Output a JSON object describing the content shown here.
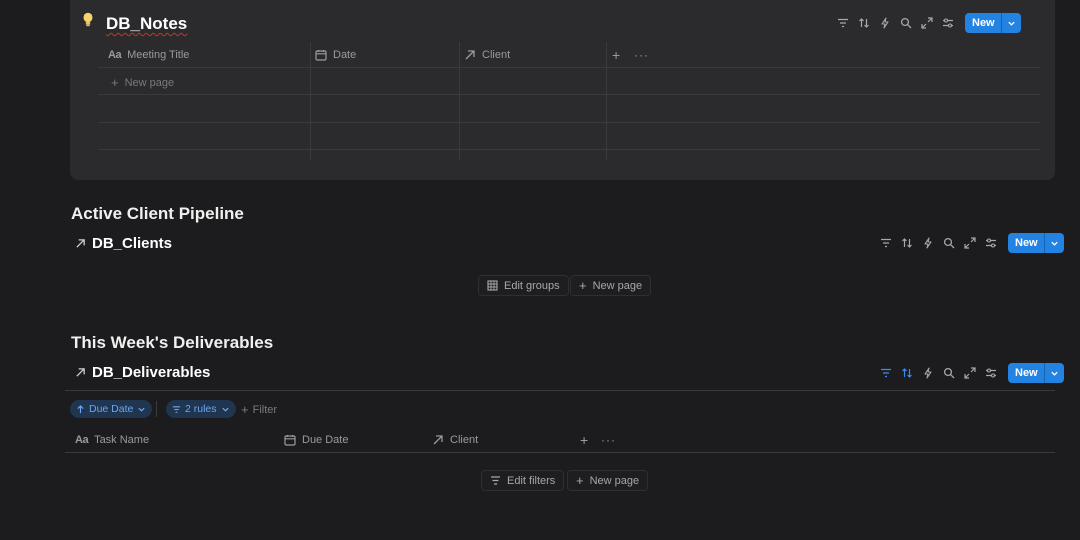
{
  "notes": {
    "title": "DB_Notes",
    "icon": "lightbulb-icon",
    "columns": [
      "Meeting Title",
      "Date",
      "Client"
    ],
    "column_icons": [
      "text-aa-icon",
      "calendar-icon",
      "relation-arrow-icon"
    ],
    "aa_glyph": "Aa",
    "new_page_label": "New page",
    "new_button_label": "New"
  },
  "clients_section": {
    "heading": "Active Client Pipeline",
    "db_title": "DB_Clients",
    "edit_groups_label": "Edit groups",
    "new_page_label": "New page",
    "new_button_label": "New"
  },
  "deliverables_section": {
    "heading": "This Week's Deliverables",
    "db_title": "DB_Deliverables",
    "sort_chip_label": "Due Date",
    "rules_chip_label": "2 rules",
    "filter_label": "Filter",
    "columns": [
      "Task Name",
      "Due Date",
      "Client"
    ],
    "aa_glyph": "Aa",
    "edit_filters_label": "Edit filters",
    "new_page_label": "New page",
    "new_button_label": "New"
  },
  "colors": {
    "background": "#1c1b1d",
    "card": "#2b2a2c",
    "accent_blue": "#2383e2",
    "chip_bg": "#1f3550",
    "chip_text": "#6ea7ee"
  }
}
